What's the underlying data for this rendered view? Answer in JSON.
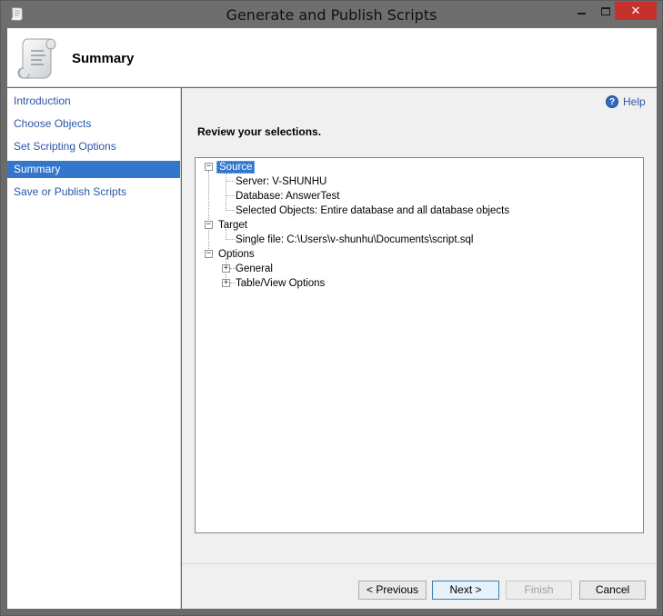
{
  "window": {
    "title": "Generate and Publish Scripts",
    "close_glyph": "✕"
  },
  "header": {
    "title": "Summary"
  },
  "nav": {
    "items": [
      {
        "label": "Introduction",
        "active": false
      },
      {
        "label": "Choose Objects",
        "active": false
      },
      {
        "label": "Set Scripting Options",
        "active": false
      },
      {
        "label": "Summary",
        "active": true
      },
      {
        "label": "Save or Publish Scripts",
        "active": false
      }
    ]
  },
  "help": {
    "label": "Help",
    "icon": "help-icon",
    "glyph": "?"
  },
  "main": {
    "heading": "Review your selections."
  },
  "tree": {
    "source": {
      "label": "Source",
      "server": "Server: V-SHUNHU",
      "database": "Database: AnswerTest",
      "selected_objects": "Selected Objects: Entire database and all database objects"
    },
    "target": {
      "label": "Target",
      "single_file": "Single file: C:\\Users\\v-shunhu\\Documents\\script.sql"
    },
    "options": {
      "label": "Options",
      "general": "General",
      "table_view": "Table/View Options"
    },
    "collapse_glyph": "−",
    "expand_glyph": "+"
  },
  "buttons": {
    "previous": "< Previous",
    "next": "Next >",
    "finish": "Finish",
    "cancel": "Cancel"
  },
  "colors": {
    "accent": "#3377cc",
    "link": "#2a56a8",
    "close_button": "#c7312b"
  }
}
